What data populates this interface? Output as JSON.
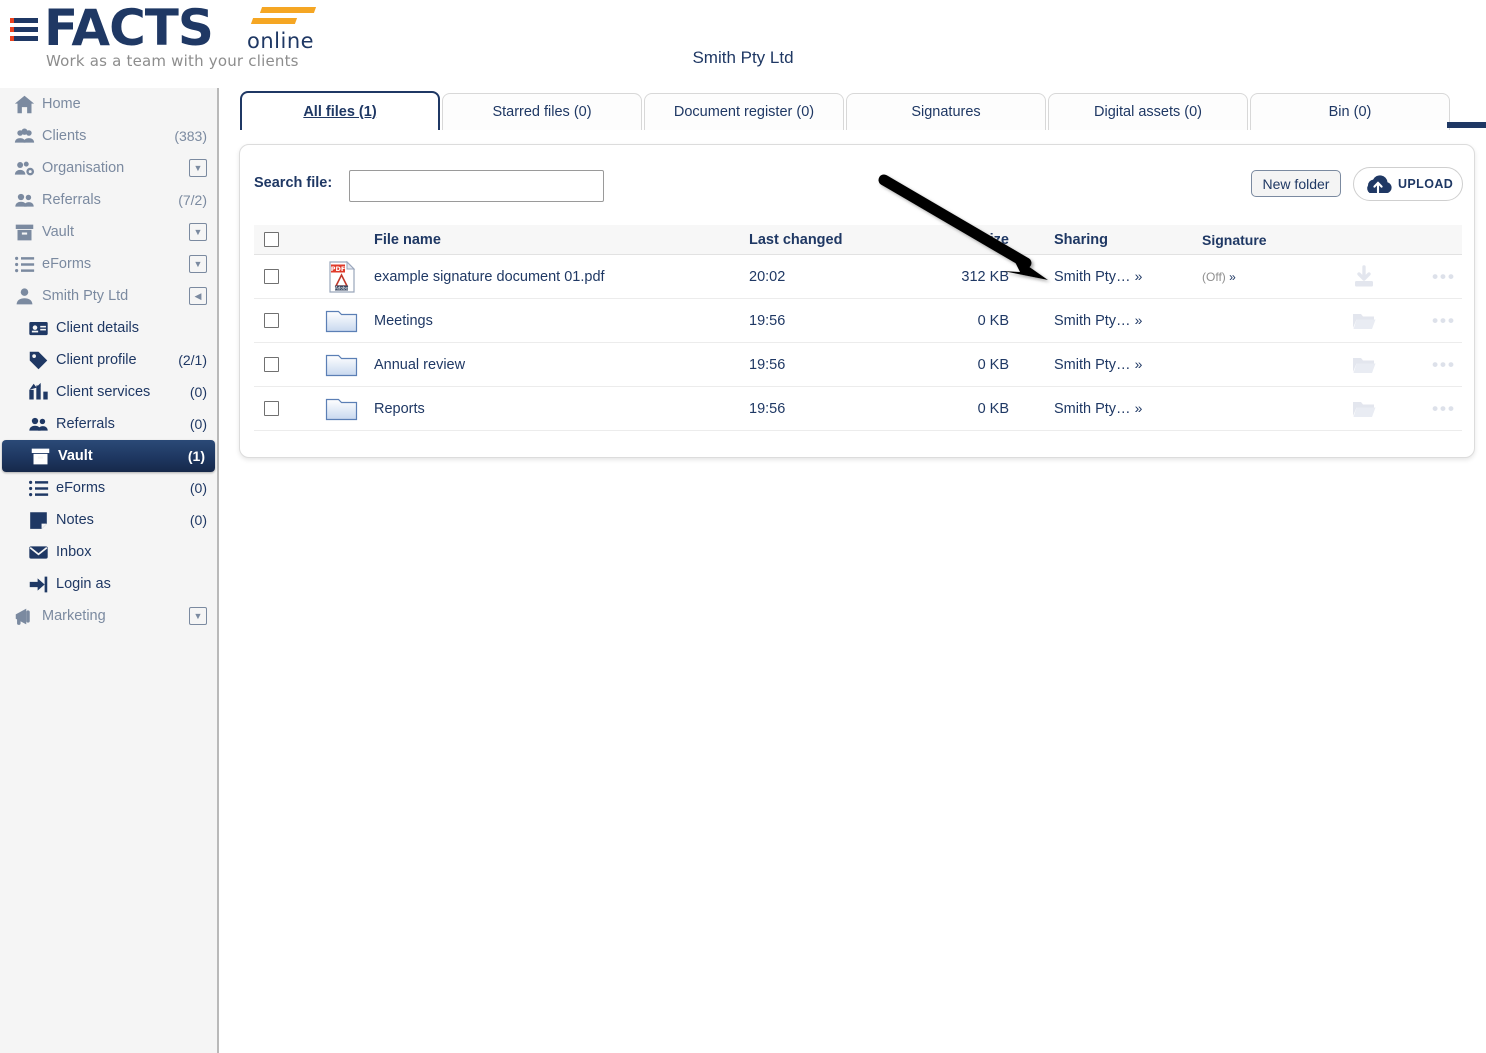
{
  "header": {
    "logo_main": "FACTS",
    "logo_sub": "online",
    "tagline": "Work as a team with your clients",
    "page_title": "Smith Pty Ltd"
  },
  "sidebar": {
    "items": [
      {
        "label": "Home",
        "count": "",
        "icon": "home-icon",
        "level": 1,
        "control": ""
      },
      {
        "label": "Clients",
        "count": "(383)",
        "icon": "clients-icon",
        "level": 1,
        "control": ""
      },
      {
        "label": "Organisation",
        "count": "",
        "icon": "organisation-icon",
        "level": 1,
        "control": "caret-down"
      },
      {
        "label": "Referrals",
        "count": "(7/2)",
        "icon": "referrals-icon",
        "level": 1,
        "control": ""
      },
      {
        "label": "Vault",
        "count": "",
        "icon": "vault-icon",
        "level": 1,
        "control": "caret-down"
      },
      {
        "label": "eForms",
        "count": "",
        "icon": "eforms-icon",
        "level": 1,
        "control": "caret-down"
      },
      {
        "label": "Smith Pty Ltd",
        "count": "",
        "icon": "person-icon",
        "level": 1,
        "control": "caret-left"
      },
      {
        "label": "Client details",
        "count": "",
        "icon": "id-card-icon",
        "level": 2,
        "control": ""
      },
      {
        "label": "Client profile",
        "count": "(2/1)",
        "icon": "tag-icon",
        "level": 2,
        "control": ""
      },
      {
        "label": "Client services",
        "count": "(0)",
        "icon": "chart-icon",
        "level": 2,
        "control": ""
      },
      {
        "label": "Referrals",
        "count": "(0)",
        "icon": "referrals-icon",
        "level": 2,
        "control": ""
      },
      {
        "label": "Vault",
        "count": "(1)",
        "icon": "vault-icon",
        "level": 2,
        "control": "",
        "active": true
      },
      {
        "label": "eForms",
        "count": "(0)",
        "icon": "eforms-icon",
        "level": 2,
        "control": ""
      },
      {
        "label": "Notes",
        "count": "(0)",
        "icon": "notes-icon",
        "level": 2,
        "control": ""
      },
      {
        "label": "Inbox",
        "count": "",
        "icon": "envelope-icon",
        "level": 2,
        "control": ""
      },
      {
        "label": "Login as",
        "count": "",
        "icon": "login-icon",
        "level": 2,
        "control": ""
      },
      {
        "label": "Marketing",
        "count": "",
        "icon": "megaphone-icon",
        "level": 1,
        "control": "caret-down"
      }
    ]
  },
  "tabs": [
    {
      "label": "All files (1)",
      "selected": true
    },
    {
      "label": "Starred files (0)",
      "selected": false
    },
    {
      "label": "Document register (0)",
      "selected": false
    },
    {
      "label": "Signatures",
      "selected": false
    },
    {
      "label": "Digital assets (0)",
      "selected": false
    },
    {
      "label": "Bin (0)",
      "selected": false
    }
  ],
  "toolbar": {
    "search_label": "Search file:",
    "search_value": "",
    "search_placeholder": "",
    "new_folder_label": "New folder",
    "upload_label": "UPLOAD"
  },
  "table": {
    "columns": [
      "File name",
      "Last changed",
      "Size",
      "Sharing",
      "Signature"
    ],
    "rows": [
      {
        "icon": "pdf-file-icon",
        "name": "example signature document 01.pdf",
        "last_changed": "20:02",
        "size": "312 KB",
        "sharing": "Smith Pty…",
        "sharing_chevron": "»",
        "signature": "(Off)",
        "signature_chevron": "»",
        "action_icon": "download-icon",
        "more_icon": "more-options-icon"
      },
      {
        "icon": "folder-icon",
        "name": "Meetings",
        "last_changed": "19:56",
        "size": "0 KB",
        "sharing": "Smith Pty…",
        "sharing_chevron": "»",
        "signature": "",
        "signature_chevron": "",
        "action_icon": "open-folder-icon",
        "more_icon": "more-options-icon"
      },
      {
        "icon": "folder-icon",
        "name": "Annual review",
        "last_changed": "19:56",
        "size": "0 KB",
        "sharing": "Smith Pty…",
        "sharing_chevron": "»",
        "signature": "",
        "signature_chevron": "",
        "action_icon": "open-folder-icon",
        "more_icon": "more-options-icon"
      },
      {
        "icon": "folder-icon",
        "name": "Reports",
        "last_changed": "19:56",
        "size": "0 KB",
        "sharing": "Smith Pty…",
        "sharing_chevron": "»",
        "signature": "",
        "signature_chevron": "",
        "action_icon": "open-folder-icon",
        "more_icon": "more-options-icon"
      }
    ]
  },
  "annotation": {
    "arrow": "black-arrow-pointing-to-sharing-column"
  },
  "colors": {
    "brand_navy": "#1f3864",
    "brand_orange": "#f5a623",
    "sidebar_bg": "#f5f5f5",
    "accent_red": "#e8421f"
  }
}
